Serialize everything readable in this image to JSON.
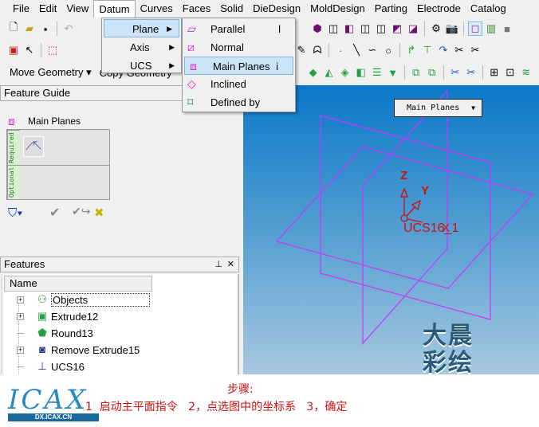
{
  "menu": [
    "File",
    "Edit",
    "View",
    "Datum",
    "Curves",
    "Faces",
    "Solid",
    "DieDesign",
    "MoldDesign",
    "Parting",
    "Electrode",
    "Catalog"
  ],
  "toolbar": {
    "move_geometry": "Move Geometry",
    "copy_geometry": "Copy Geometry"
  },
  "datum_menu": [
    {
      "label": "Plane"
    },
    {
      "label": "Axis"
    },
    {
      "label": "UCS"
    }
  ],
  "plane_menu": [
    {
      "label": "Parallel",
      "shortcut": "l",
      "icon": "parallel-plane-icon"
    },
    {
      "label": "Normal",
      "shortcut": "",
      "icon": "normal-plane-icon"
    },
    {
      "label": "Main Planes",
      "shortcut": "i",
      "icon": "main-planes-icon"
    },
    {
      "label": "Inclined",
      "shortcut": "",
      "icon": "inclined-plane-icon"
    },
    {
      "label": "Defined by",
      "shortcut": "",
      "icon": "defined-by-plane-icon"
    }
  ],
  "feature_guide": {
    "title": "Feature Guide",
    "command": "Main Planes",
    "required": "Required",
    "optional": "Optional"
  },
  "features": {
    "title": "Features",
    "pin": "⊥",
    "close": "✕",
    "column": "Name",
    "items": [
      {
        "label": "Objects",
        "expandable": true
      },
      {
        "label": "Extrude12",
        "expandable": true
      },
      {
        "label": "Round13",
        "expandable": false
      },
      {
        "label": "Remove Extrude15",
        "expandable": true
      },
      {
        "label": "UCS16",
        "expandable": false
      }
    ]
  },
  "viewport": {
    "dropdown": "Main Planes",
    "axis_z": "Z",
    "axis_y": "Y",
    "axis_x": "X",
    "ucs_label": "UCS16_1",
    "watermark": "大晨 彩绘",
    "plane_color": "#cc33ff",
    "ucs_color": "#d01010"
  },
  "footer": {
    "logo": "ICAX",
    "logo_sub": "DX.ICAX.CN",
    "steps_title": "步骤:",
    "steps": "1  启动主平面指令   2，点选图中的坐标系   3，确定"
  }
}
